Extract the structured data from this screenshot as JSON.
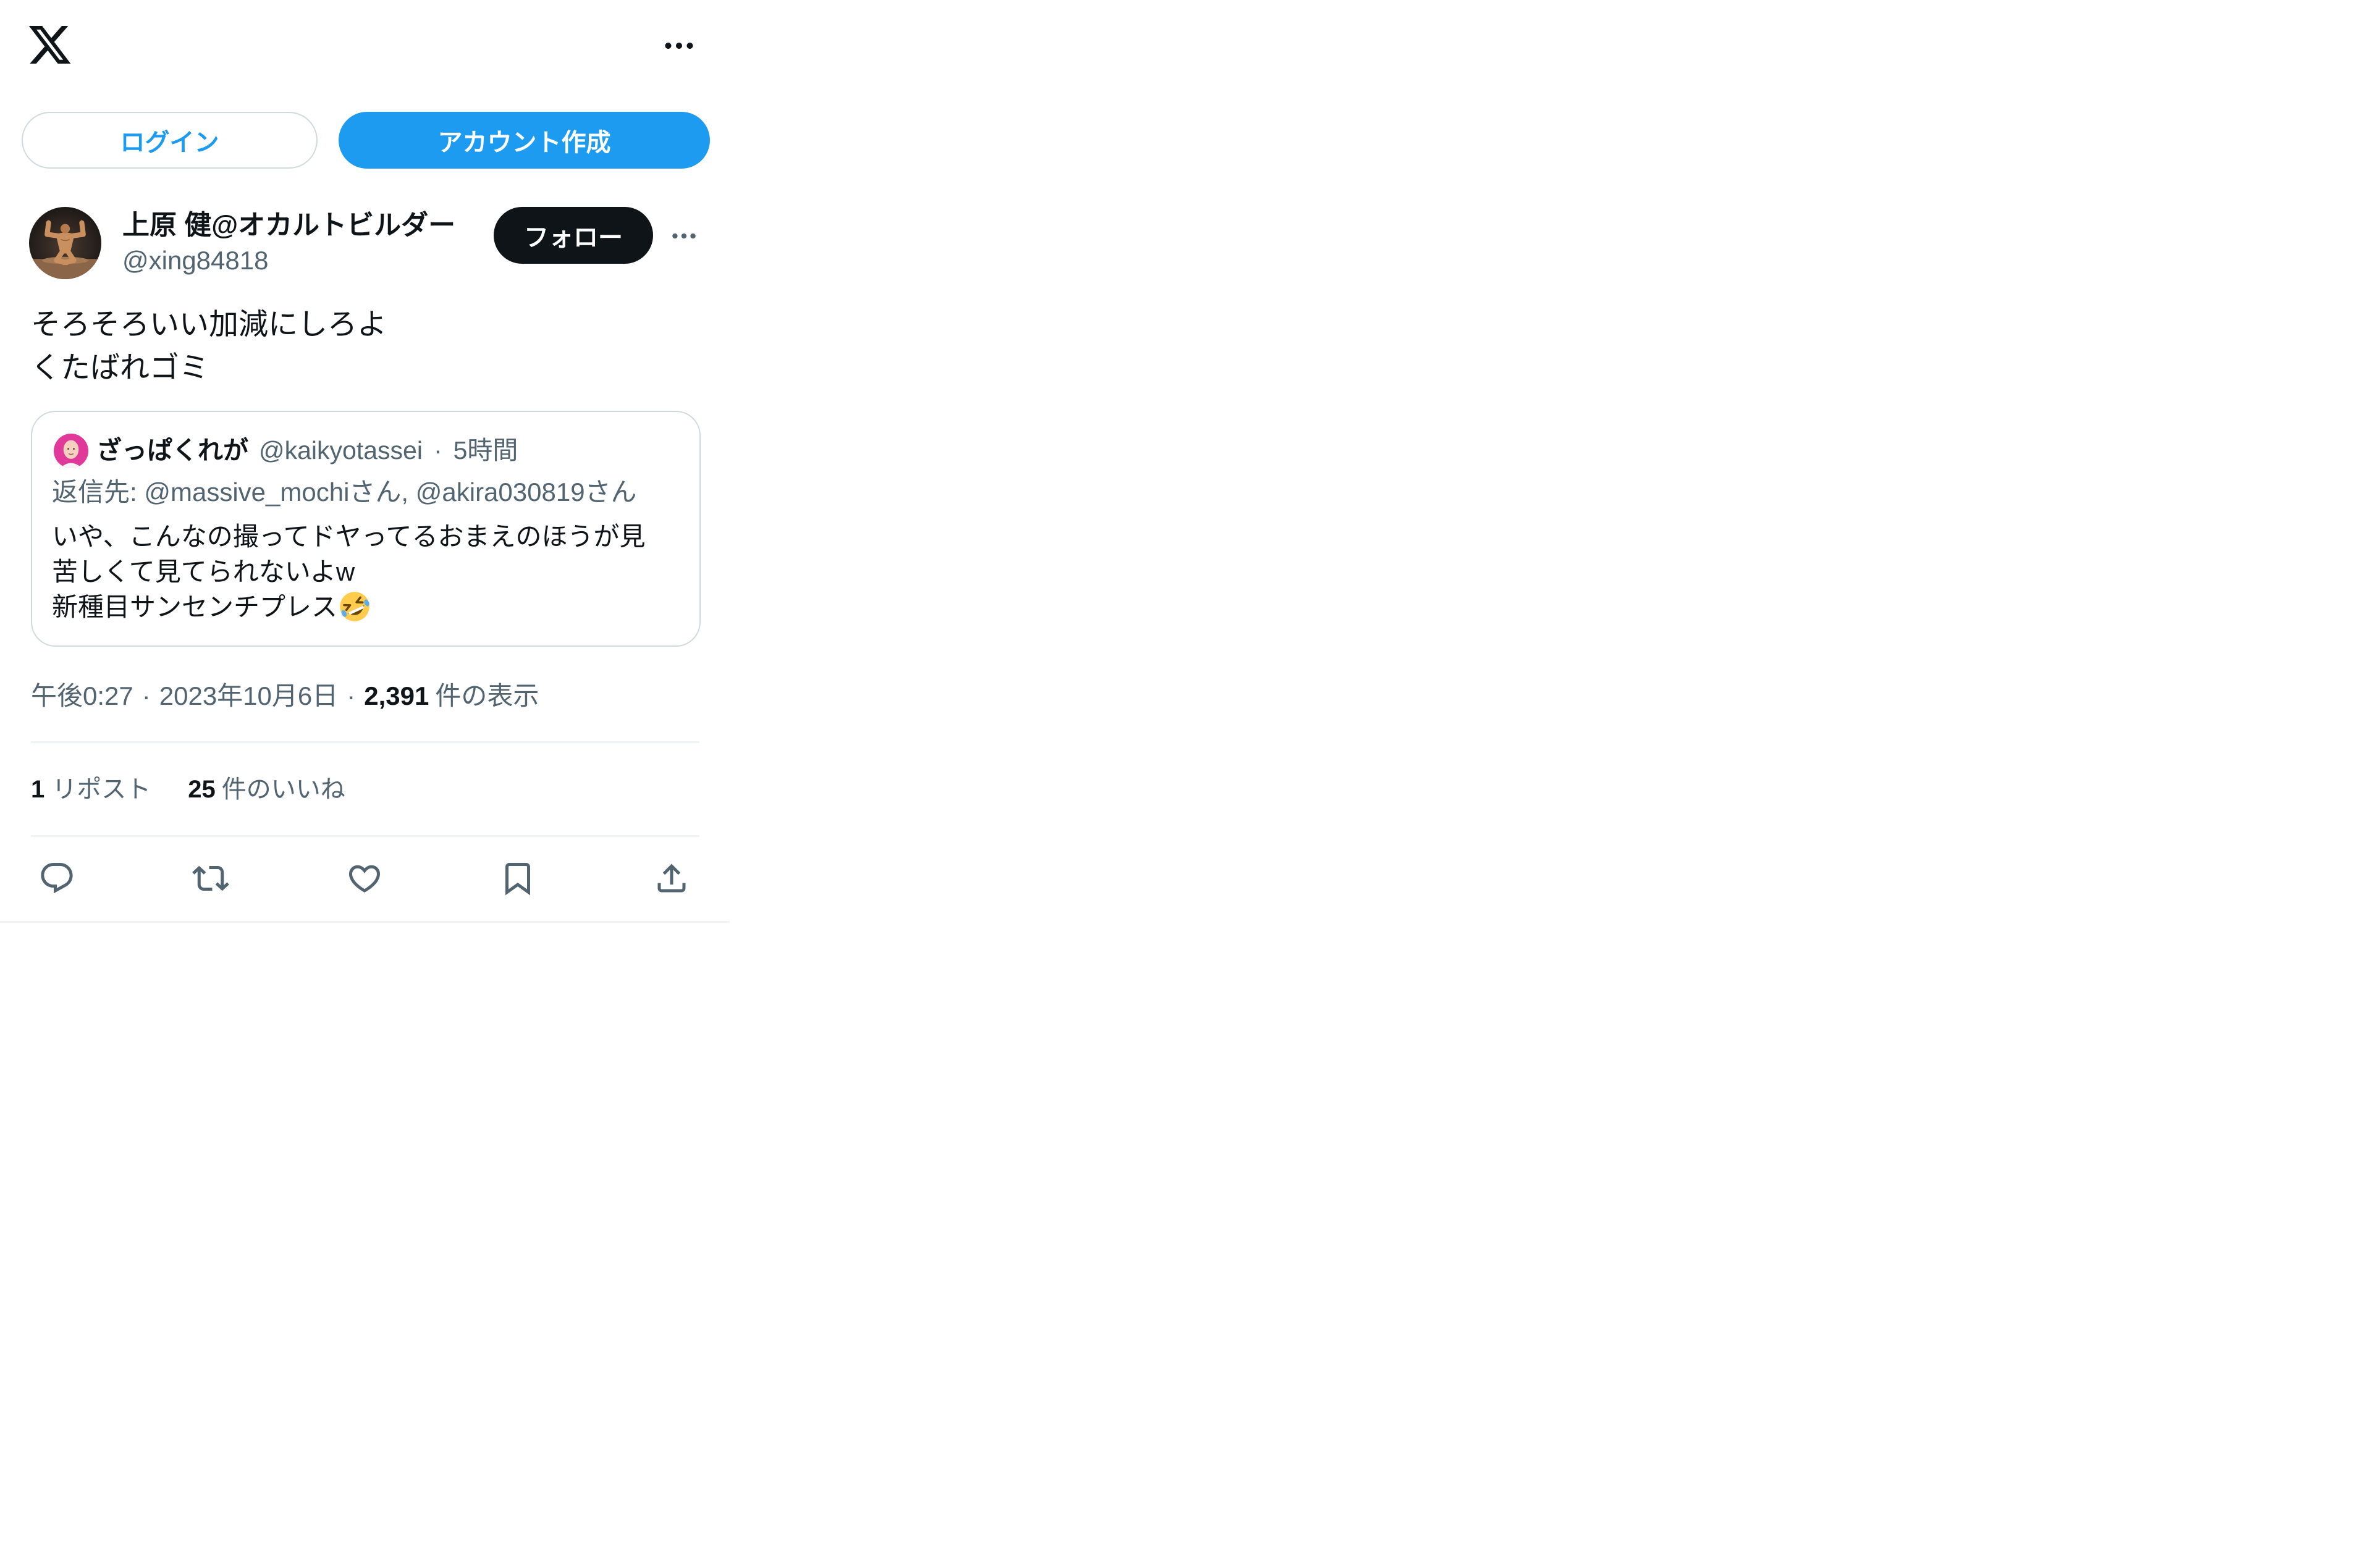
{
  "header": {
    "logo_icon": "x-logo-icon",
    "more_icon": "more-horizontal-icon"
  },
  "auth": {
    "login_label": "ログイン",
    "signup_label": "アカウント作成"
  },
  "tweet": {
    "author": {
      "name": "上原 健@オカルトビルダー",
      "handle": "@xing84818",
      "avatar_icon": "bodybuilder-avatar"
    },
    "follow_label": "フォロー",
    "more_icon": "more-horizontal-icon",
    "text_lines": [
      "そろそろいい加減にしろよ",
      "くたばれゴミ"
    ],
    "quote": {
      "avatar_icon": "pink-portrait-avatar",
      "author_name": "ざっぱくれが",
      "handle": "@kaikyotassei",
      "separator": "·",
      "time": "5時間",
      "reply_to": "返信先: @massive_mochiさん, @akira030819さん",
      "text_lines": [
        "いや、こんなの撮ってドヤってるおまえのほうが見",
        "苦しくて見てられないよw",
        "新種目サンセンチプレス"
      ],
      "emoji_icon": "rolling-on-the-floor-laughing-emoji"
    },
    "meta": {
      "time": "午後0:27",
      "separator": "·",
      "date": "2023年10月6日",
      "views_count": "2,391",
      "views_label": "件の表示"
    },
    "stats": {
      "reposts_count": "1",
      "reposts_label": "リポスト",
      "likes_count": "25",
      "likes_label": "件のいいね"
    },
    "actions": [
      "reply-icon",
      "repost-icon",
      "like-icon",
      "bookmark-icon",
      "share-icon"
    ]
  },
  "colors": {
    "text": "#0f1419",
    "secondary": "#536471",
    "accent": "#1d9bf0",
    "border": "#cfd9de",
    "divider": "#eff3f4"
  }
}
